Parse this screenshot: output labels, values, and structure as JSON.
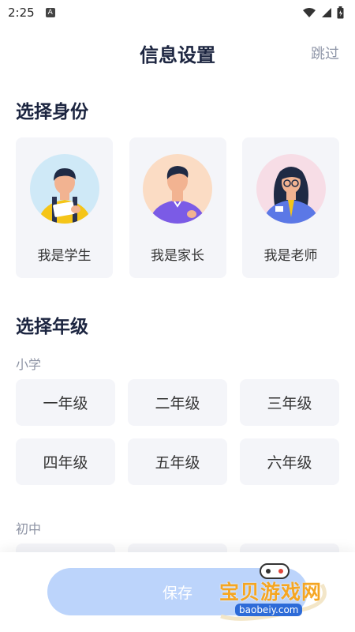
{
  "status_bar": {
    "time": "2:25",
    "notification_glyph": "A",
    "icons": [
      "wifi-icon",
      "signal-icon",
      "battery-icon"
    ]
  },
  "header": {
    "title": "信息设置",
    "skip_label": "跳过"
  },
  "identity": {
    "title": "选择身份",
    "options": [
      {
        "label": "我是学生",
        "avatar": "student-avatar",
        "bg": "#cfe9f7"
      },
      {
        "label": "我是家长",
        "avatar": "parent-avatar",
        "bg": "#fbdcc4"
      },
      {
        "label": "我是老师",
        "avatar": "teacher-avatar",
        "bg": "#f7dde6"
      }
    ]
  },
  "grade": {
    "title": "选择年级",
    "groups": [
      {
        "label": "小学",
        "items": [
          "一年级",
          "二年级",
          "三年级",
          "四年级",
          "五年级",
          "六年级"
        ]
      },
      {
        "label": "初中"
      }
    ]
  },
  "footer": {
    "save_label": "保存"
  },
  "watermark": {
    "text": "宝贝游戏网",
    "url": "baobeiy.com"
  },
  "colors": {
    "title": "#1c2540",
    "card_bg": "#f4f5f9",
    "save_bg": "#bcd4fb",
    "muted": "#8c92a3"
  }
}
